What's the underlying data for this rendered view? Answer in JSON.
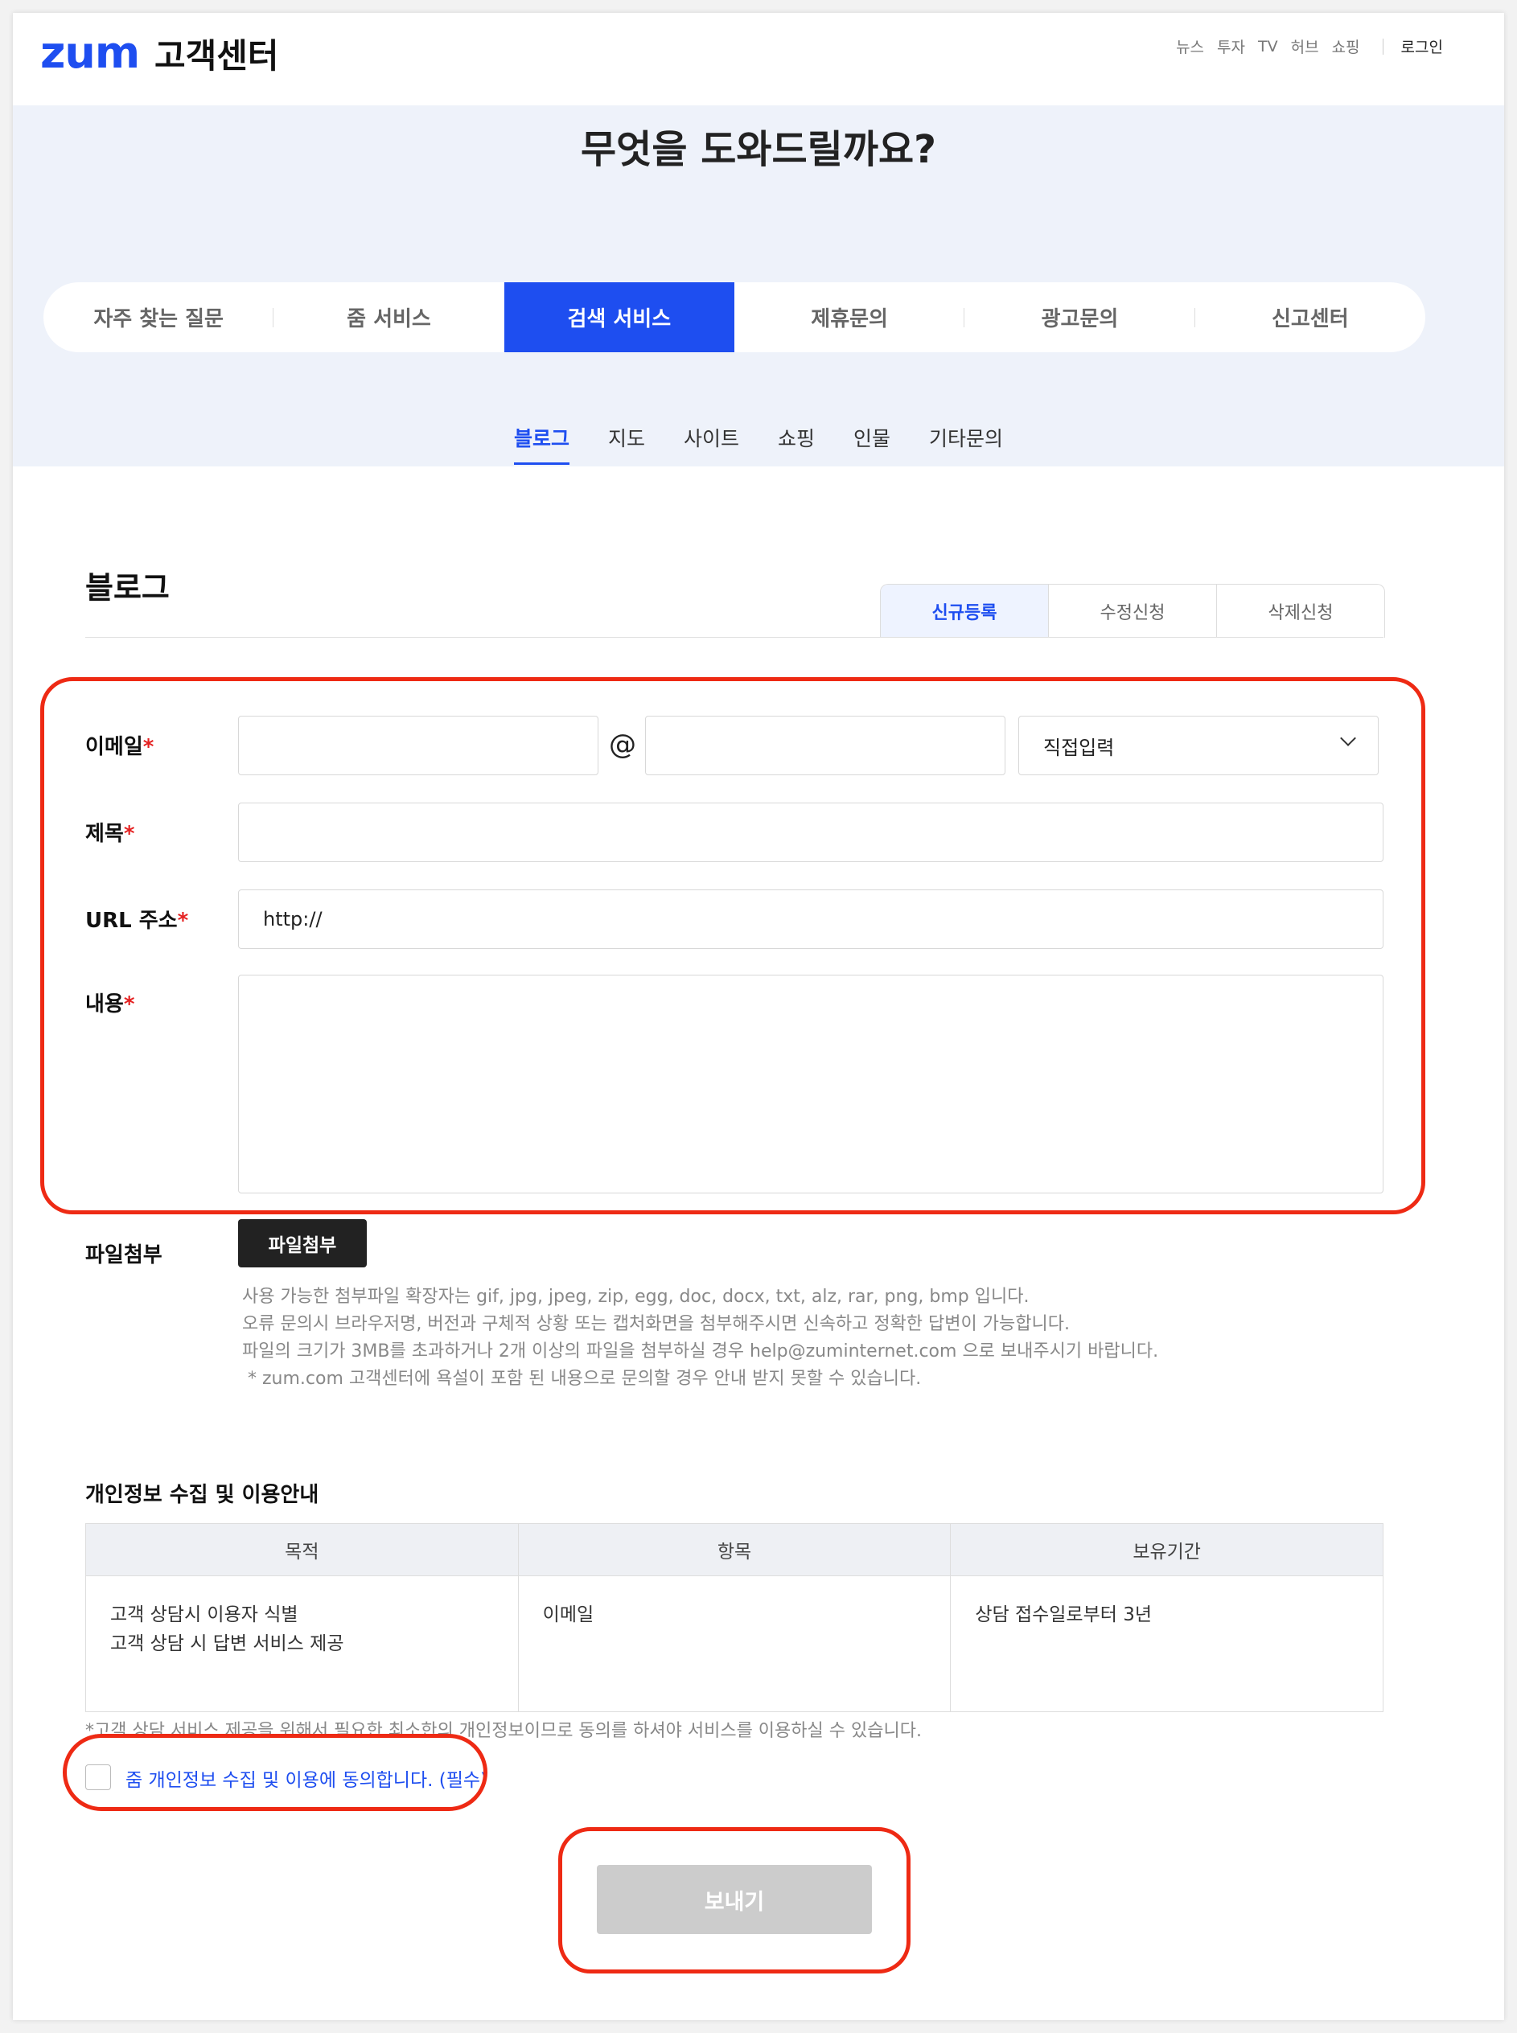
{
  "header": {
    "logo": "zum",
    "title": "고객센터",
    "nav": [
      "뉴스",
      "투자",
      "TV",
      "허브",
      "쇼핑"
    ],
    "login": "로그인"
  },
  "hero": {
    "question": "무엇을 도와드릴까요?",
    "tabs": [
      "자주 찾는 질문",
      "줌 서비스",
      "검색 서비스",
      "제휴문의",
      "광고문의",
      "신고센터"
    ],
    "active_tab": "검색 서비스",
    "subnav": [
      "블로그",
      "지도",
      "사이트",
      "쇼핑",
      "인물",
      "기타문의"
    ],
    "active_subnav": "블로그"
  },
  "section": {
    "title": "블로그",
    "segments": [
      "신규등록",
      "수정신청",
      "삭제신청"
    ],
    "active_segment": "신규등록"
  },
  "form": {
    "email_label": "이메일",
    "at_sign": "@",
    "email_domain_select": "직접입력",
    "subject_label": "제목",
    "url_label": "URL 주소",
    "url_value": "http://",
    "content_label": "내용",
    "required_mark": "*",
    "attach_label": "파일첨부",
    "attach_button": "파일첨부",
    "notes": [
      "사용 가능한 첨부파일 확장자는 gif, jpg, jpeg, zip, egg, doc, docx, txt, alz, rar, png, bmp 입니다.",
      "오류 문의시 브라우저명, 버전과 구체적 상황 또는 캡처화면을 첨부해주시면 신속하고 정확한 답변이 가능합니다.",
      "파일의 크기가 3MB를 초과하거나 2개 이상의 파일을 첨부하실 경우 help@zuminternet.com 으로 보내주시기 바랍니다.",
      " * zum.com 고객센터에 욕설이 포함 된 내용으로 문의할 경우 안내 받지 못할 수 있습니다."
    ]
  },
  "privacy": {
    "title": "개인정보 수집 및 이용안내",
    "headers": [
      "목적",
      "항목",
      "보유기간"
    ],
    "row": {
      "purpose_1": "고객 상담시 이용자 식별",
      "purpose_2": "고객 상담 시 답변 서비스 제공",
      "item": "이메일",
      "period": "상담 접수일로부터 3년"
    },
    "note": "*고객 상담 서비스 제공을 위해서 필요한 최소한의 개인정보이므로 동의를 하셔야 서비스를 이용하실 수 있습니다.",
    "agree_label": "줌 개인정보 수집 및 이용에 동의합니다. (필수)",
    "agreed": false
  },
  "submit": {
    "label": "보내기",
    "enabled": false
  },
  "colors": {
    "brand": "#1e4ef0",
    "required": "#e52222",
    "highlight": "#ee2a14",
    "hero_bg": "#eef2fa"
  }
}
